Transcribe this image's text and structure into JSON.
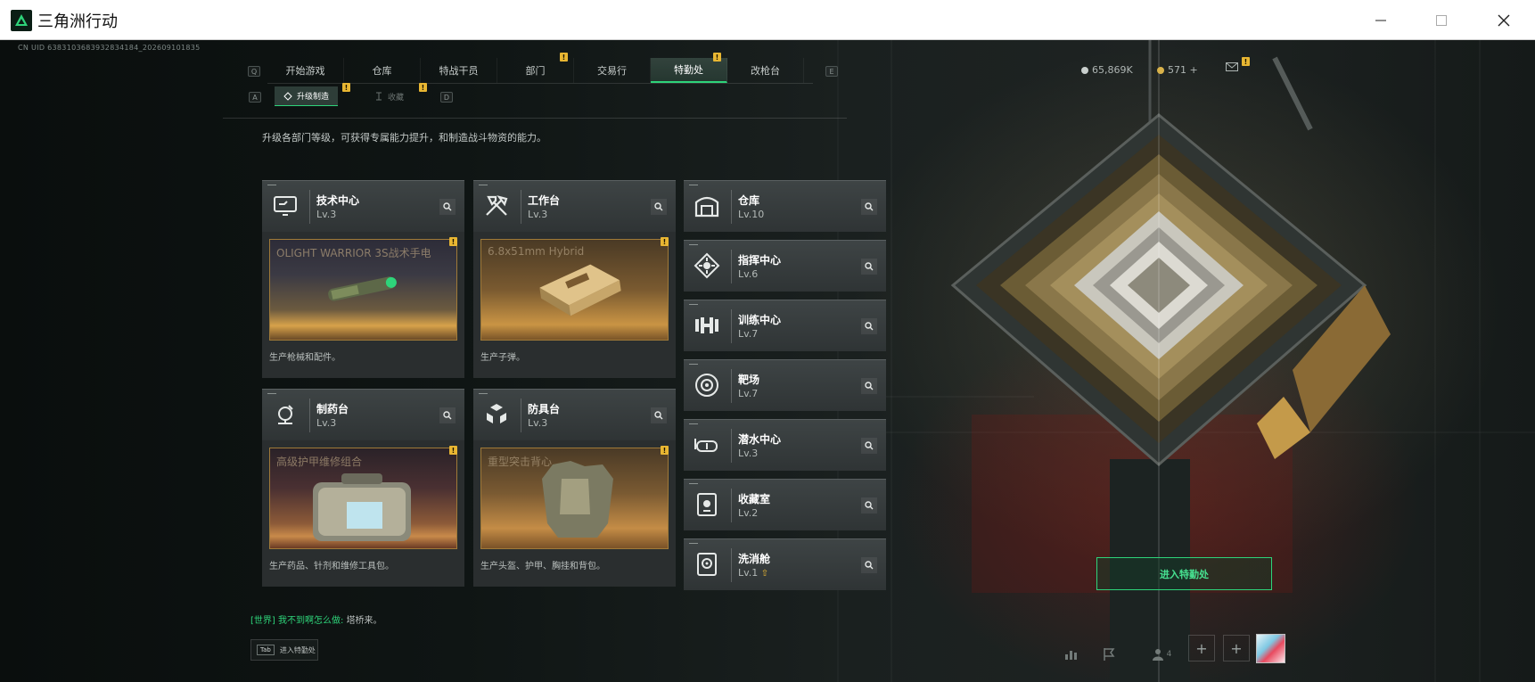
{
  "window": {
    "title": "三角洲行动",
    "controls": [
      "minimize",
      "maximize",
      "close"
    ]
  },
  "uid": "CN UID 6383103683932834184_202609101835",
  "nav": {
    "left_key": "Q",
    "right_key": "E",
    "tabs": [
      {
        "label": "开始游戏",
        "active": false,
        "badge": ""
      },
      {
        "label": "仓库",
        "active": false,
        "badge": ""
      },
      {
        "label": "特战干员",
        "active": false,
        "badge": ""
      },
      {
        "label": "部门",
        "active": false,
        "badge": "!"
      },
      {
        "label": "交易行",
        "active": false,
        "badge": ""
      },
      {
        "label": "特勤处",
        "active": true,
        "badge": "!"
      },
      {
        "label": "改枪台",
        "active": false,
        "badge": ""
      }
    ]
  },
  "currency": {
    "hafcoin": "65,869K",
    "tickets": "571 +",
    "mail_badge": "!"
  },
  "subnav": {
    "left_key": "A",
    "right_key": "D",
    "tabs": [
      {
        "label": "升级制造",
        "active": true,
        "badge": "!"
      },
      {
        "label": "收藏",
        "active": false,
        "badge": "!"
      }
    ]
  },
  "description": "升级各部门等级，可获得专属能力提升，和制造战斗物资的能力。",
  "facilities_main": [
    {
      "name": "技术中心",
      "level": "Lv.3",
      "icon": "tech-center-icon",
      "product": "OLIGHT WARRIOR 3S战术手电",
      "desc": "生产枪械和配件。",
      "badge": "!"
    },
    {
      "name": "工作台",
      "level": "Lv.3",
      "icon": "workbench-icon",
      "product": "6.8x51mm Hybrid",
      "desc": "生产子弹。",
      "badge": "!"
    },
    {
      "name": "制药台",
      "level": "Lv.3",
      "icon": "pharmacy-icon",
      "product": "高级护甲维修组合",
      "desc": "生产药品、针剂和维修工具包。",
      "badge": "!"
    },
    {
      "name": "防具台",
      "level": "Lv.3",
      "icon": "armor-bench-icon",
      "product": "重型突击背心",
      "desc": "生产头盔、护甲、胸挂和背包。",
      "badge": "!"
    }
  ],
  "facilities_side": [
    {
      "name": "仓库",
      "level": "Lv.10",
      "icon": "warehouse-icon"
    },
    {
      "name": "指挥中心",
      "level": "Lv.6",
      "icon": "command-center-icon"
    },
    {
      "name": "训练中心",
      "level": "Lv.7",
      "icon": "training-center-icon"
    },
    {
      "name": "靶场",
      "level": "Lv.7",
      "icon": "shooting-range-icon"
    },
    {
      "name": "潜水中心",
      "level": "Lv.3",
      "icon": "diving-center-icon"
    },
    {
      "name": "收藏室",
      "level": "Lv.2",
      "icon": "collection-room-icon"
    },
    {
      "name": "洗消舱",
      "level": "Lv.1",
      "icon": "decon-chamber-icon"
    }
  ],
  "enter_button": "进入特勤处",
  "chat": {
    "channel": "[世界]",
    "sender": "我不到啊怎么做:",
    "message": "塔桥来。"
  },
  "tab_hint": {
    "key": "Tab",
    "label": "进入特勤处"
  },
  "bottom": {
    "friends_count": "4"
  },
  "colors": {
    "accent": "#2ed47a",
    "badge": "#e8b632",
    "card": "#3a3f40"
  }
}
